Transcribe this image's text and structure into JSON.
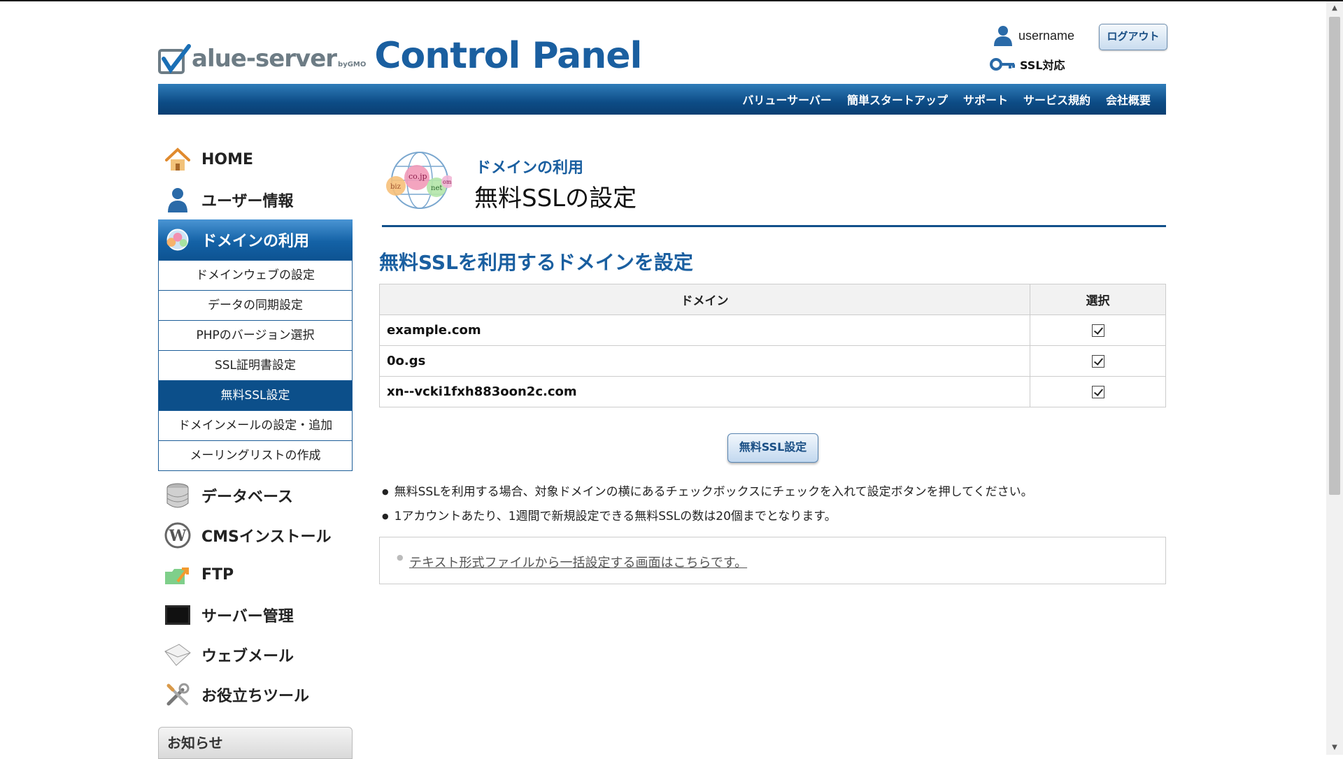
{
  "header": {
    "logo_brand": "Value-server",
    "logo_sub": "by GMO",
    "logo_title": "Control Panel",
    "username": "username",
    "logout_label": "ログアウト",
    "ssl_label": "SSL対応"
  },
  "nav": {
    "links": [
      "バリューサーバー",
      "簡単スタートアップ",
      "サポート",
      "サービス規約",
      "会社概要"
    ]
  },
  "sidebar": {
    "items": [
      {
        "label": "HOME",
        "icon": "house-icon"
      },
      {
        "label": "ユーザー情報",
        "icon": "user-icon"
      },
      {
        "label": "ドメインの利用",
        "icon": "domain-globe-icon",
        "active": true
      },
      {
        "label": "データベース",
        "icon": "database-icon"
      },
      {
        "label": "CMSインストール",
        "icon": "wordpress-icon"
      },
      {
        "label": "FTP",
        "icon": "ftp-icon"
      },
      {
        "label": "サーバー管理",
        "icon": "monitor-icon"
      },
      {
        "label": "ウェブメール",
        "icon": "envelope-icon"
      },
      {
        "label": "お役立ちツール",
        "icon": "tools-icon"
      }
    ],
    "submenu": [
      "ドメインウェブの設定",
      "データの同期設定",
      "PHPのバージョン選択",
      "SSL証明書設定",
      "無料SSL設定",
      "ドメインメールの設定・追加",
      "メーリングリストの作成"
    ],
    "selected_submenu": "無料SSL設定",
    "notice_label": "お知らせ"
  },
  "main": {
    "page_sub": "ドメインの利用",
    "page_title": "無料SSLの設定",
    "section_title": "無料SSLを利用するドメインを設定",
    "table": {
      "headers": [
        "ドメイン",
        "選択"
      ],
      "rows": [
        {
          "domain": "example.com",
          "checked": true
        },
        {
          "domain": "0o.gs",
          "checked": true
        },
        {
          "domain": "xn--vcki1fxh883oon2c.com",
          "checked": true
        }
      ]
    },
    "submit_label": "無料SSL設定",
    "notes": [
      "無料SSLを利用する場合、対象ドメインの横にあるチェックボックスにチェックを入れて設定ボタンを押してください。",
      "1アカウントあたり、1週間で新規設定できる無料SSLの数は20個までとなります。"
    ],
    "bulk_link": "テキスト形式ファイルから一括設定する画面はこちらです。"
  },
  "colors": {
    "brand_blue": "#1a5fa0",
    "nav_blue": "#0d4c86",
    "selected_blue": "#0c4f8a"
  }
}
